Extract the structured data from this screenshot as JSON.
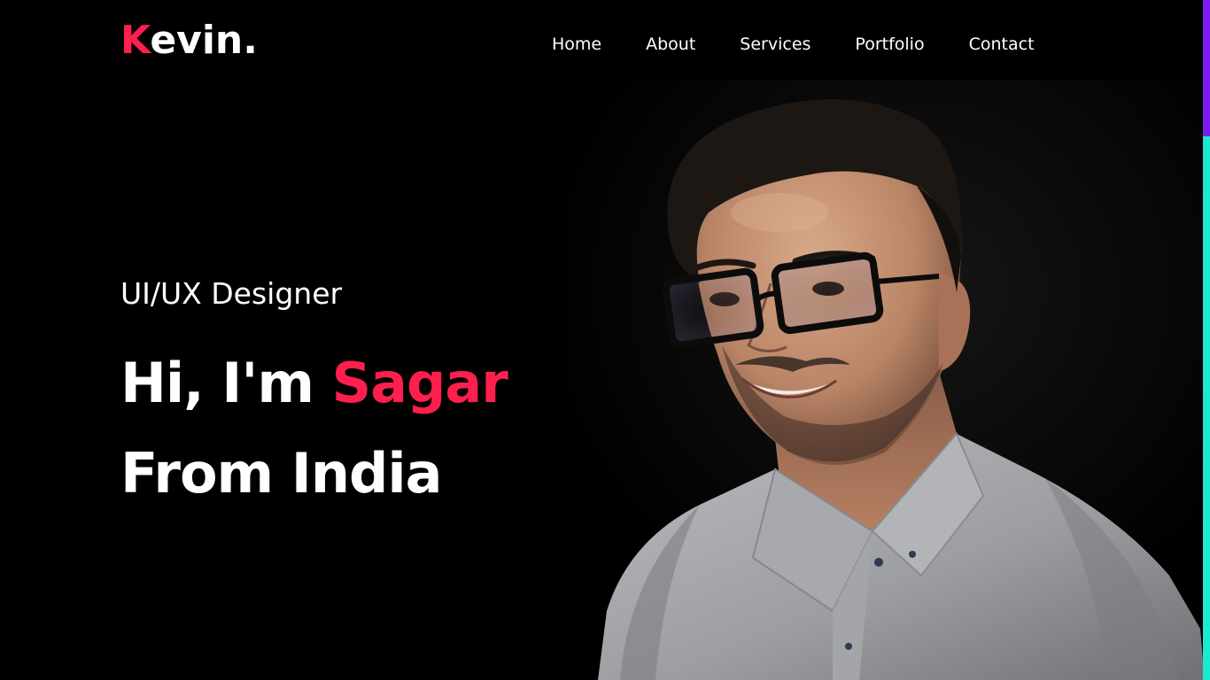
{
  "header": {
    "logo_initial": "K",
    "logo_rest": "evin.",
    "nav": [
      {
        "label": "Home"
      },
      {
        "label": "About"
      },
      {
        "label": "Services"
      },
      {
        "label": "Portfolio"
      },
      {
        "label": "Contact"
      }
    ]
  },
  "hero": {
    "subtitle": "UI/UX Designer",
    "greeting": "Hi, I'm ",
    "name": "Sagar",
    "line2": "From India"
  },
  "scroll": {
    "progress": 0.2
  },
  "colors": {
    "accent": "#ff1f4e",
    "background": "#000000",
    "text": "#ffffff",
    "scroll_track": "#1de9d2",
    "scroll_thumb": "#7a1cf0"
  }
}
